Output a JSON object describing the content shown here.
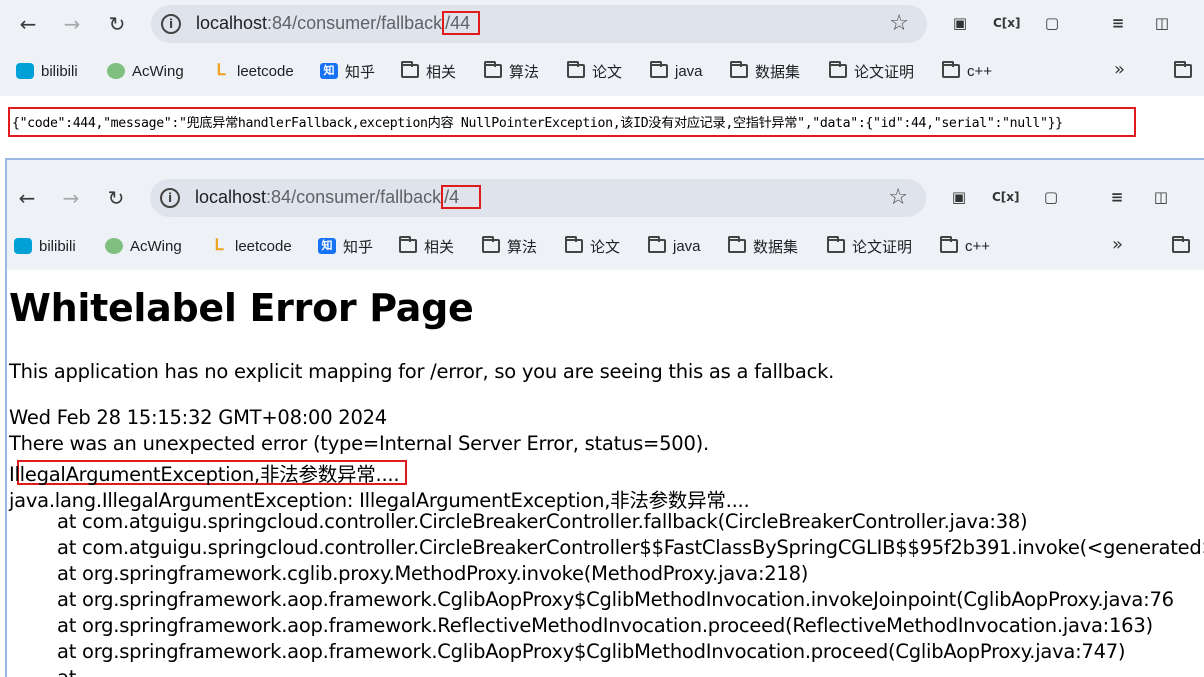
{
  "window1": {
    "url_host": "localhost",
    "url_path_prefix": ":84/consumer/fallback",
    "url_path_highlight": "/44",
    "bookmarks": [
      "bilibili",
      "AcWing",
      "leetcode",
      "知乎",
      "相关",
      "算法",
      "论文",
      "java",
      "数据集",
      "论文证明",
      "c++"
    ],
    "bookmarks_more": "»",
    "json_response": "{\"code\":444,\"message\":\"兜底异常handlerFallback,exception内容  NullPointerException,该ID没有对应记录,空指针异常\",\"data\":{\"id\":44,\"serial\":\"null\"}}"
  },
  "window2": {
    "url_host": "localhost",
    "url_path_prefix": ":84/consumer/fallback",
    "url_path_highlight": "/4",
    "bookmarks": [
      "bilibili",
      "AcWing",
      "leetcode",
      "知乎",
      "相关",
      "算法",
      "论文",
      "java",
      "数据集",
      "论文证明",
      "c++"
    ],
    "bookmarks_more": "»",
    "error_page": {
      "title": "Whitelabel Error Page",
      "description": "This application has no explicit mapping for /error, so you are seeing this as a fallback.",
      "timestamp": "Wed Feb 28 15:15:32 GMT+08:00 2024",
      "summary": "There was an unexpected error (type=Internal Server Error, status=500).",
      "message": "IllegalArgumentException,非法参数异常....",
      "exception": "java.lang.IllegalArgumentException: IllegalArgumentException,非法参数异常....",
      "stack": [
        "at com.atguigu.springcloud.controller.CircleBreakerController.fallback(CircleBreakerController.java:38)",
        "at com.atguigu.springcloud.controller.CircleBreakerController$$FastClassBySpringCGLIB$$95f2b391.invoke(<generated>",
        "at org.springframework.cglib.proxy.MethodProxy.invoke(MethodProxy.java:218)",
        "at org.springframework.aop.framework.CglibAopProxy$CglibMethodInvocation.invokeJoinpoint(CglibAopProxy.java:76",
        "at org.springframework.aop.framework.ReflectiveMethodInvocation.proceed(ReflectiveMethodInvocation.java:163)",
        "at org.springframework.aop.framework.CglibAopProxy$CglibMethodInvocation.proceed(CglibAopProxy.java:747)",
        "at"
      ]
    }
  },
  "icons": {
    "back": "←",
    "forward": "→",
    "reload": "↻",
    "info": "i",
    "star": "☆",
    "ext_cx": "C[x]"
  }
}
